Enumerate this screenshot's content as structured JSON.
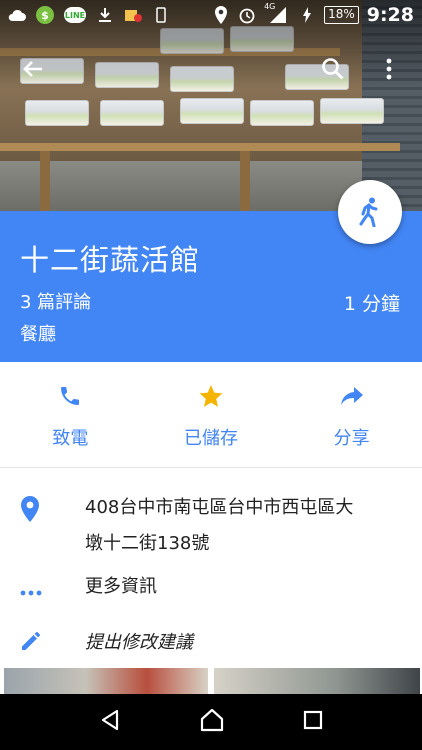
{
  "status_bar": {
    "line_badge": "LINE",
    "network": "4G",
    "battery": "18%",
    "time": "9:28"
  },
  "place": {
    "name": "十二街蔬活館",
    "reviews": "3 篇評論",
    "category": "餐廳",
    "travel_time": "1 分鐘"
  },
  "actions": [
    {
      "label": "致電",
      "icon": "phone-icon"
    },
    {
      "label": "已儲存",
      "icon": "star-icon"
    },
    {
      "label": "分享",
      "icon": "share-icon"
    }
  ],
  "info": {
    "address_line1": "408台中市南屯區台中市西屯區大",
    "address_line2": "墩十二街138號",
    "more_info": "更多資訊",
    "suggest_edit": "提出修改建議"
  },
  "colors": {
    "brand_blue": "#4285f4",
    "star_yellow": "#f4b400"
  }
}
